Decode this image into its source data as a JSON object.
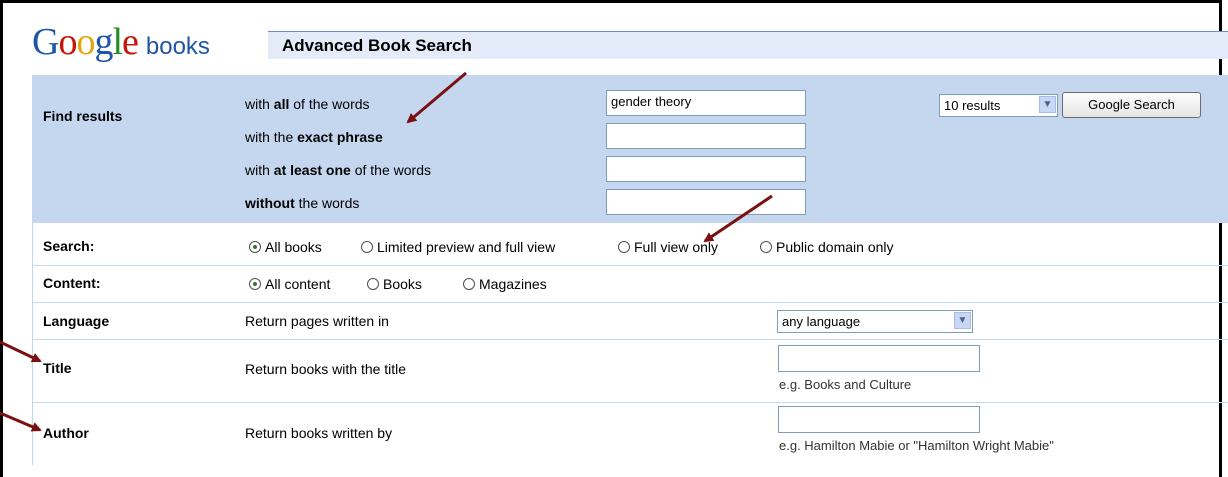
{
  "logo": {
    "google_letters": [
      "G",
      "o",
      "o",
      "g",
      "l",
      "e"
    ],
    "books": "books"
  },
  "header": {
    "title": "Advanced Book Search"
  },
  "find": {
    "label": "Find results",
    "rows": [
      {
        "pre": "with ",
        "bold": "all",
        "post": " of the words",
        "value": "gender theory"
      },
      {
        "pre": "with the ",
        "bold": "exact phrase",
        "post": "",
        "value": ""
      },
      {
        "pre": "with ",
        "bold": "at least one",
        "post": " of the words",
        "value": ""
      },
      {
        "pre": "",
        "bold": "without",
        "post": " the words",
        "value": ""
      }
    ],
    "results_select": "10 results",
    "search_button": "Google Search"
  },
  "search": {
    "label": "Search:",
    "options": [
      "All books",
      "Limited preview and full view",
      "Full view only",
      "Public domain only"
    ],
    "selected": 0
  },
  "content": {
    "label": "Content:",
    "options": [
      "All content",
      "Books",
      "Magazines"
    ],
    "selected": 0
  },
  "language": {
    "label": "Language",
    "desc": "Return pages written in",
    "select": "any language"
  },
  "title": {
    "label": "Title",
    "desc": "Return books with the title",
    "hint": "e.g. Books and Culture"
  },
  "author": {
    "label": "Author",
    "desc": "Return books written by",
    "hint": "e.g. Hamilton Mabie or \"Hamilton Wright Mabie\""
  },
  "colors": {
    "panel": "#c5d7ef",
    "title_bar": "#e5ecf9",
    "arrow": "#7a1010"
  }
}
